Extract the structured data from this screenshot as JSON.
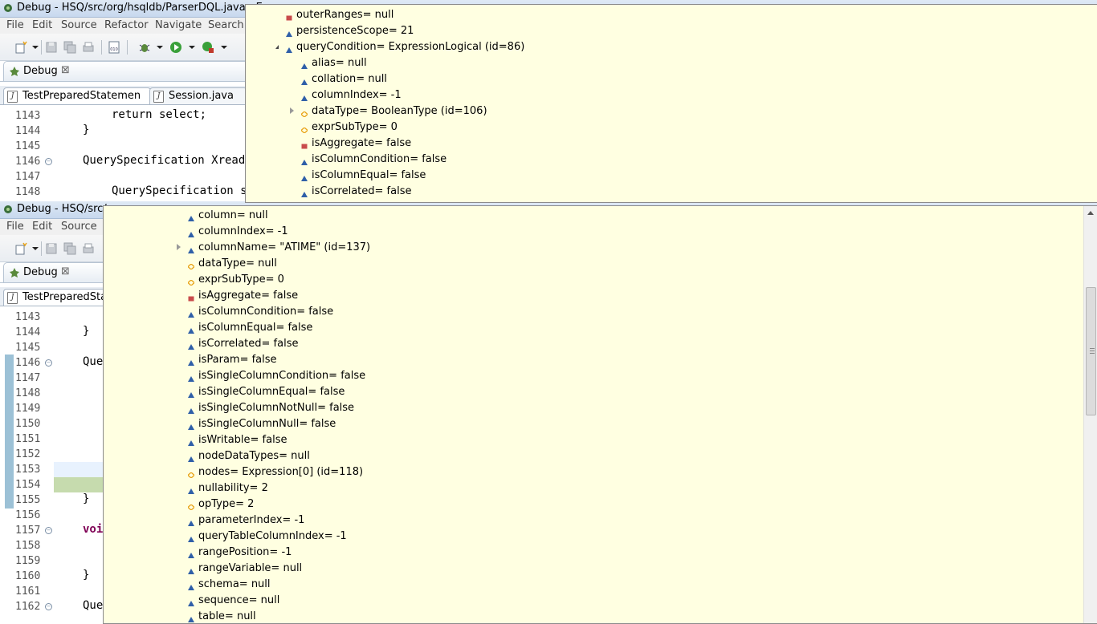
{
  "window1": {
    "title": "Debug - HSQ/src/org/hsqldb/ParserDQL.java - Ec",
    "menus": [
      "File",
      "Edit",
      "Source",
      "Refactor",
      "Navigate",
      "Search"
    ],
    "view_label": "Debug",
    "view_close": "⊠",
    "editor_tabs": [
      "TestPreparedStatemen",
      "Session.java"
    ],
    "lines": [
      {
        "num": "1143",
        "code": "return select;",
        "kw": "return"
      },
      {
        "num": "1144",
        "code": "}"
      },
      {
        "num": "1145",
        "code": ""
      },
      {
        "num": "1146",
        "code": "QuerySpecification XreadQuery"
      },
      {
        "num": "1147",
        "code": ""
      },
      {
        "num": "1148",
        "code": "QuerySpecification select"
      }
    ]
  },
  "window2": {
    "title": "Debug - HSQ/src/",
    "menus": [
      "File",
      "Edit",
      "Source"
    ],
    "view_label": "Debug",
    "view_close": "⊠",
    "editor_tabs": [
      "TestPreparedStat"
    ],
    "lines": [
      {
        "num": "1143",
        "code": ""
      },
      {
        "num": "1144",
        "code": "}"
      },
      {
        "num": "1145",
        "code": ""
      },
      {
        "num": "1146",
        "code": "Que"
      },
      {
        "num": "1147",
        "code": ""
      },
      {
        "num": "1148",
        "code": ""
      },
      {
        "num": "1149",
        "code": ""
      },
      {
        "num": "1150",
        "code": ""
      },
      {
        "num": "1151",
        "code": ""
      },
      {
        "num": "1152",
        "code": ""
      },
      {
        "num": "1153",
        "code": ""
      },
      {
        "num": "1154",
        "code": ""
      },
      {
        "num": "1155",
        "code": "}"
      },
      {
        "num": "1156",
        "code": ""
      },
      {
        "num": "1157",
        "code": "voi",
        "kw": "voi"
      },
      {
        "num": "1158",
        "code": ""
      },
      {
        "num": "1159",
        "code": ""
      },
      {
        "num": "1160",
        "code": "}"
      },
      {
        "num": "1161",
        "code": ""
      },
      {
        "num": "1162",
        "code": "Que"
      }
    ]
  },
  "popup_top": {
    "rows": [
      {
        "text": "outerRanges= null",
        "icon": "red-square"
      },
      {
        "text": "persistenceScope= 21",
        "icon": "blue-triangle"
      },
      {
        "text": "queryCondition= ExpressionLogical  (id=86)",
        "icon": "blue-triangle",
        "expander": "expanded"
      },
      {
        "text": "alias= null",
        "icon": "blue-triangle"
      },
      {
        "text": "collation= null",
        "icon": "blue-triangle"
      },
      {
        "text": "columnIndex= -1",
        "icon": "blue-triangle"
      },
      {
        "text": "dataType= BooleanType  (id=106)",
        "icon": "orange-diamond",
        "expander": "collapsed"
      },
      {
        "text": "exprSubType= 0",
        "icon": "orange-diamond"
      },
      {
        "text": "isAggregate= false",
        "icon": "red-square"
      },
      {
        "text": "isColumnCondition= false",
        "icon": "blue-triangle"
      },
      {
        "text": "isColumnEqual= false",
        "icon": "blue-triangle"
      },
      {
        "text": "isCorrelated= false",
        "icon": "blue-triangle"
      }
    ]
  },
  "popup_main": {
    "rows": [
      {
        "text": "column= null",
        "icon": "blue-triangle"
      },
      {
        "text": "columnIndex= -1",
        "icon": "blue-triangle"
      },
      {
        "text": "columnName= \"ATIME\" (id=137)",
        "icon": "blue-triangle",
        "expander": "collapsed"
      },
      {
        "text": "dataType= null",
        "icon": "orange-diamond"
      },
      {
        "text": "exprSubType= 0",
        "icon": "orange-diamond"
      },
      {
        "text": "isAggregate= false",
        "icon": "red-square"
      },
      {
        "text": "isColumnCondition= false",
        "icon": "blue-triangle"
      },
      {
        "text": "isColumnEqual= false",
        "icon": "blue-triangle"
      },
      {
        "text": "isCorrelated= false",
        "icon": "blue-triangle"
      },
      {
        "text": "isParam= false",
        "icon": "blue-triangle"
      },
      {
        "text": "isSingleColumnCondition= false",
        "icon": "blue-triangle"
      },
      {
        "text": "isSingleColumnEqual= false",
        "icon": "blue-triangle"
      },
      {
        "text": "isSingleColumnNotNull= false",
        "icon": "blue-triangle"
      },
      {
        "text": "isSingleColumnNull= false",
        "icon": "blue-triangle"
      },
      {
        "text": "isWritable= false",
        "icon": "blue-triangle"
      },
      {
        "text": "nodeDataTypes= null",
        "icon": "blue-triangle"
      },
      {
        "text": "nodes= Expression[0]  (id=118)",
        "icon": "orange-diamond"
      },
      {
        "text": "nullability= 2",
        "icon": "blue-triangle"
      },
      {
        "text": "opType= 2",
        "icon": "orange-diamond"
      },
      {
        "text": "parameterIndex= -1",
        "icon": "blue-triangle"
      },
      {
        "text": "queryTableColumnIndex= -1",
        "icon": "blue-triangle"
      },
      {
        "text": "rangePosition= -1",
        "icon": "blue-triangle"
      },
      {
        "text": "rangeVariable= null",
        "icon": "blue-triangle"
      },
      {
        "text": "schema= null",
        "icon": "blue-triangle"
      },
      {
        "text": "sequence= null",
        "icon": "blue-triangle"
      },
      {
        "text": "table= null",
        "icon": "blue-triangle"
      }
    ]
  },
  "colors": {
    "popup_bg": "#ffffe1",
    "blue_icon": "#2f5fa8",
    "red_icon": "#c94b4b",
    "orange_icon": "#e8a317",
    "keyword": "#7f0055"
  }
}
